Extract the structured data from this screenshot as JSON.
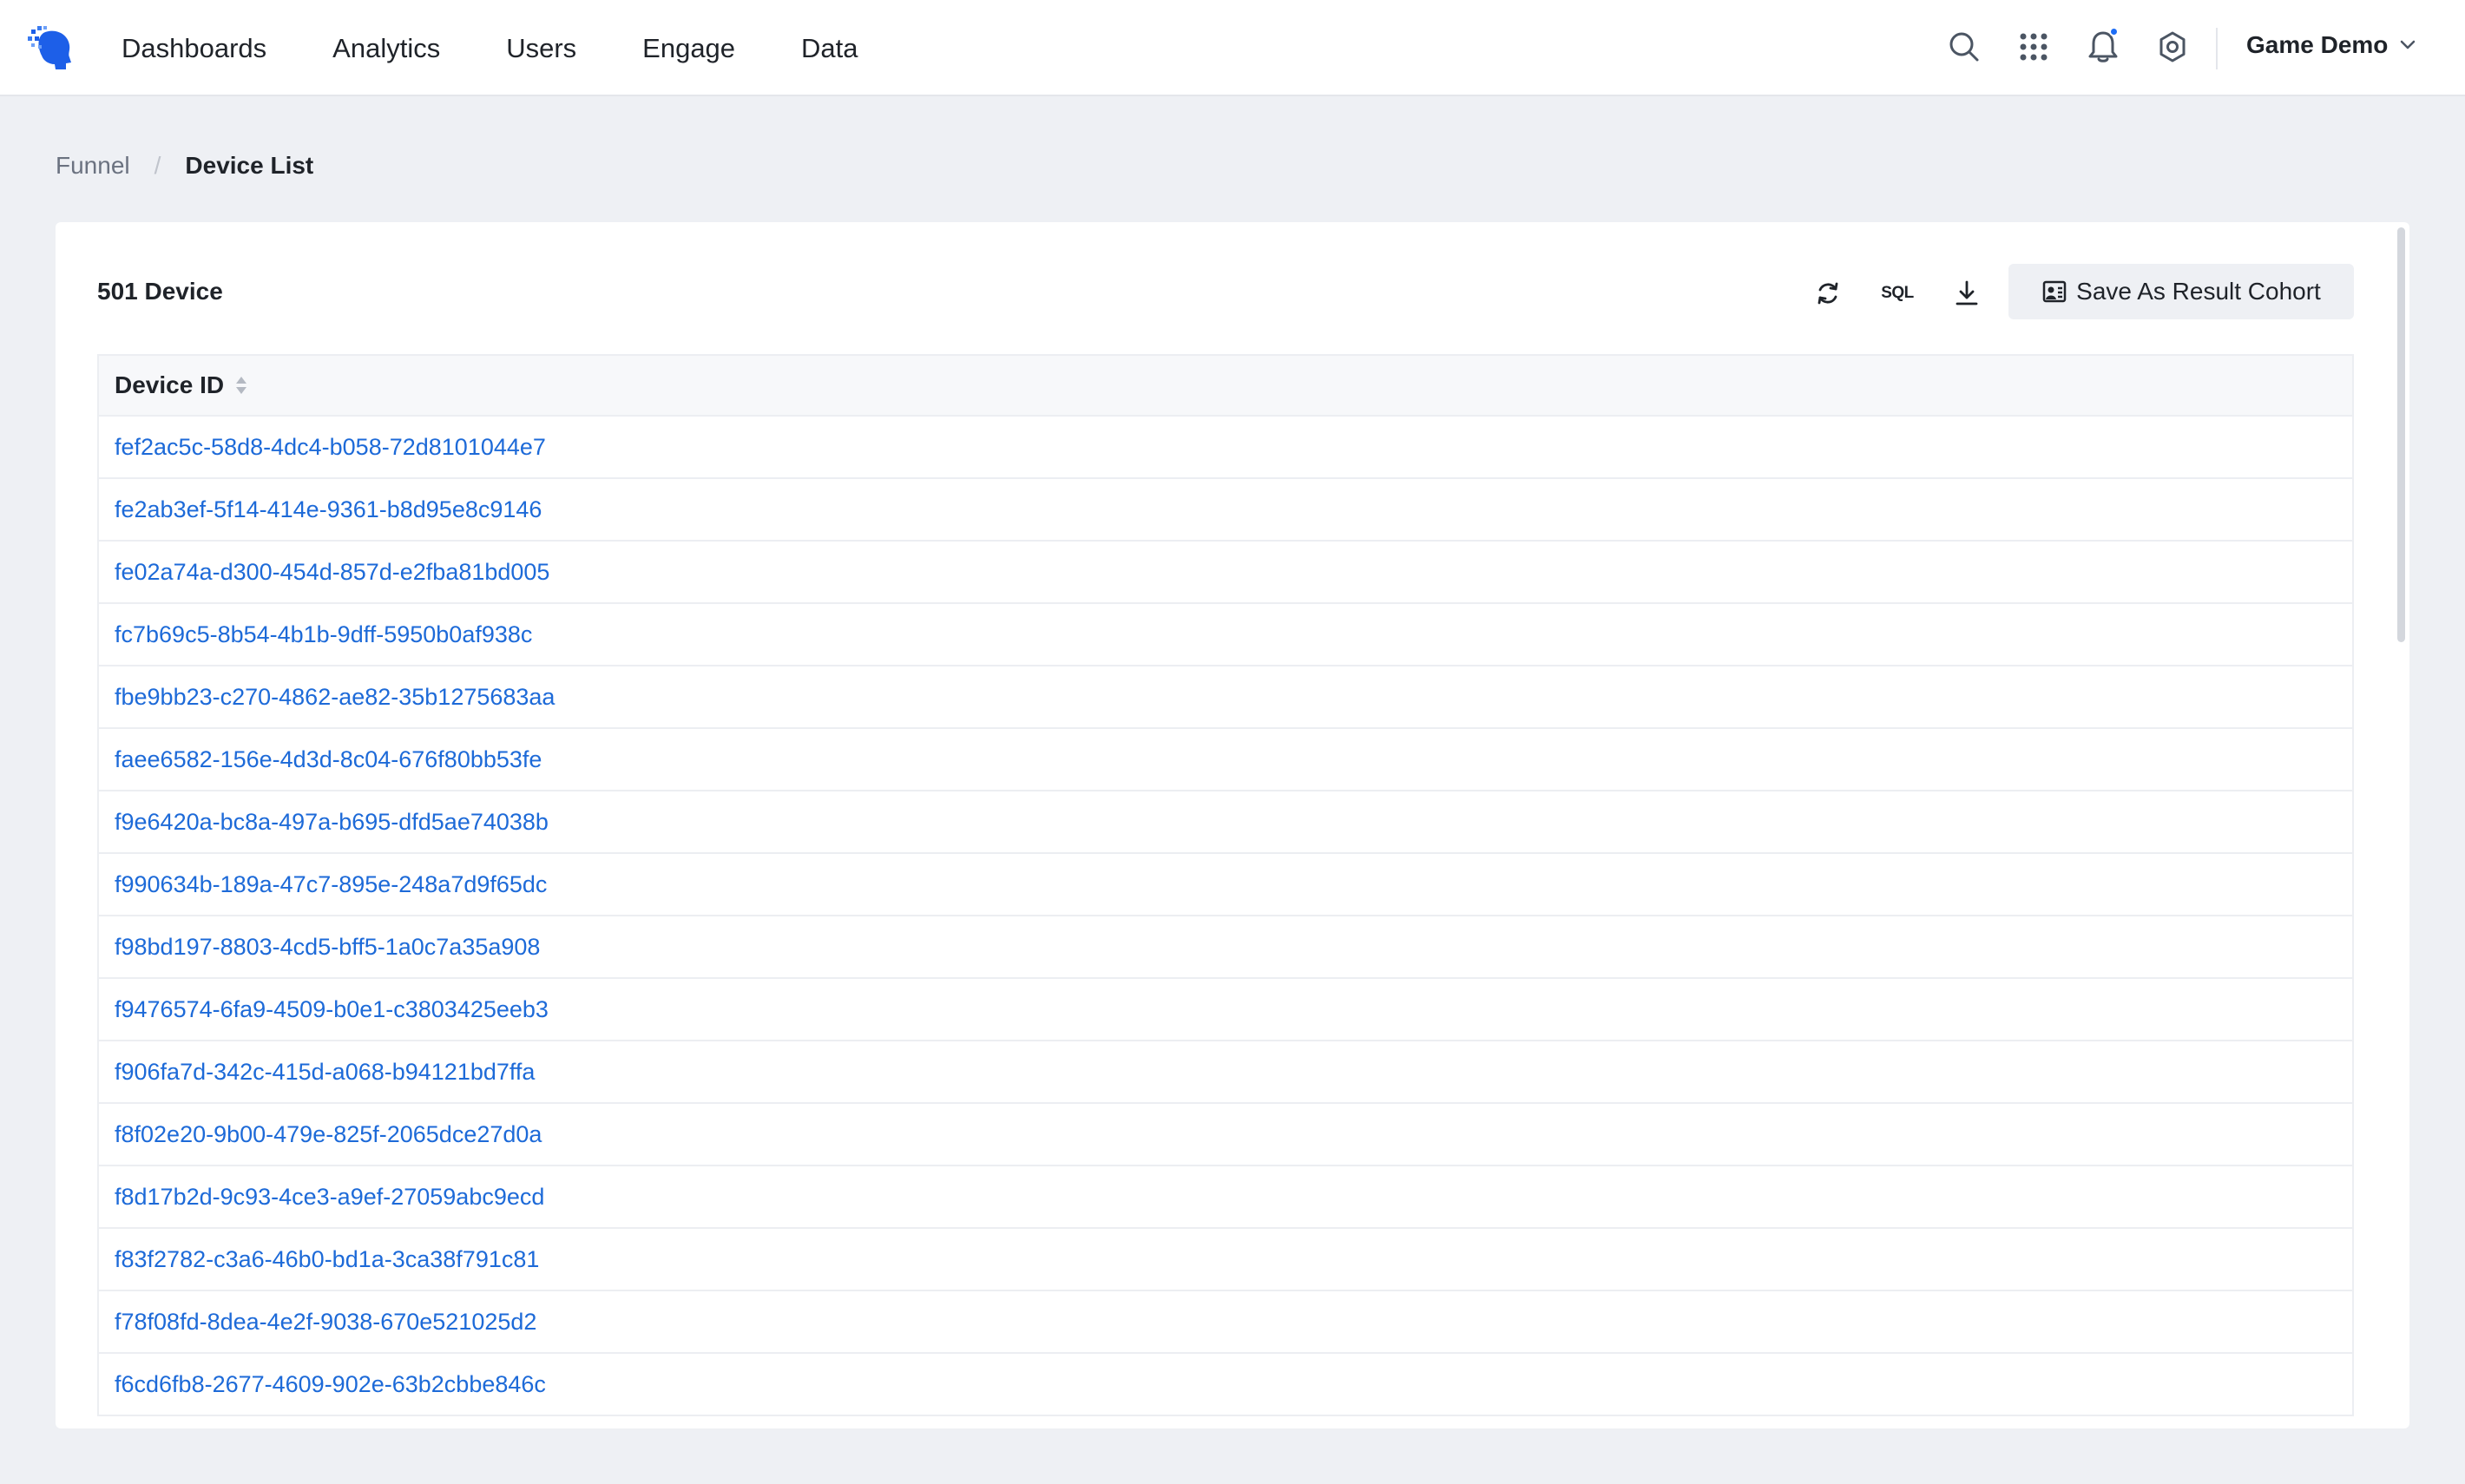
{
  "nav": {
    "items": [
      "Dashboards",
      "Analytics",
      "Users",
      "Engage",
      "Data"
    ]
  },
  "header": {
    "project_name": "Game Demo",
    "icons": [
      "search-icon",
      "apps-grid-icon",
      "bell-icon",
      "gear-icon"
    ]
  },
  "breadcrumb": {
    "parent": "Funnel",
    "separator": "/",
    "current": "Device List"
  },
  "card": {
    "title": "501 Device",
    "sql_label": "SQL",
    "save_label": "Save As Result Cohort"
  },
  "table": {
    "column": "Device ID",
    "rows": [
      "fef2ac5c-58d8-4dc4-b058-72d8101044e7",
      "fe2ab3ef-5f14-414e-9361-b8d95e8c9146",
      "fe02a74a-d300-454d-857d-e2fba81bd005",
      "fc7b69c5-8b54-4b1b-9dff-5950b0af938c",
      "fbe9bb23-c270-4862-ae82-35b1275683aa",
      "faee6582-156e-4d3d-8c04-676f80bb53fe",
      "f9e6420a-bc8a-497a-b695-dfd5ae74038b",
      "f990634b-189a-47c7-895e-248a7d9f65dc",
      "f98bd197-8803-4cd5-bff5-1a0c7a35a908",
      "f9476574-6fa9-4509-b0e1-c3803425eeb3",
      "f906fa7d-342c-415d-a068-b94121bd7ffa",
      "f8f02e20-9b00-479e-825f-2065dce27d0a",
      "f8d17b2d-9c93-4ce3-a9ef-27059abc9ecd",
      "f83f2782-c3a6-46b0-bd1a-3ca38f791c81",
      "f78f08fd-8dea-4e2f-9038-670e521025d2",
      "f6cd6fb8-2677-4609-902e-63b2cbbe846c"
    ]
  },
  "colors": {
    "link": "#1d6ad8",
    "accent": "#1d6df5",
    "page_bg": "#eef0f4"
  }
}
